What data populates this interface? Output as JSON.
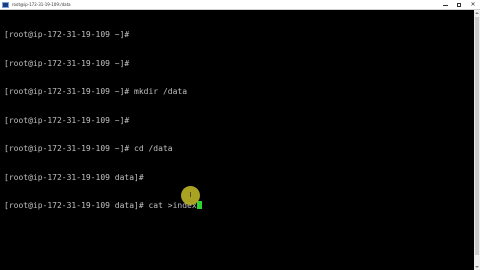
{
  "window": {
    "title": "root@ip-172-31-19-109:/data",
    "controls": {
      "minimize": "minimize",
      "maximize": "maximize",
      "close": "✕"
    }
  },
  "terminal": {
    "lines": [
      "[root@ip-172-31-19-109 ~]#",
      "[root@ip-172-31-19-109 ~]#",
      "[root@ip-172-31-19-109 ~]# mkdir /data",
      "[root@ip-172-31-19-109 ~]#",
      "[root@ip-172-31-19-109 ~]# cd /data",
      "[root@ip-172-31-19-109 data]#",
      "[root@ip-172-31-19-109 data]# cat >index"
    ],
    "cursor_color": "#2fd22f",
    "text_color": "#c0c0c0",
    "background": "#000000"
  },
  "mouse": {
    "icon": "ibeam-cursor-icon",
    "glyph": "I",
    "highlight_color": "#c8be28"
  }
}
